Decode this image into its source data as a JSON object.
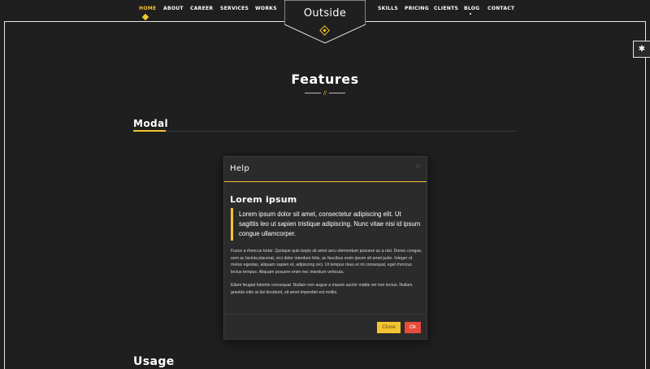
{
  "nav": {
    "left": [
      "HOME",
      "ABOUT",
      "CAREER",
      "SERVICES",
      "WORKS"
    ],
    "right": [
      "SKILLS",
      "PRICING",
      "CLIENTS",
      "BLOG",
      "CONTACT"
    ]
  },
  "logo": {
    "text": "Outside"
  },
  "settings": {
    "icon": "gear-icon",
    "glyph": "✱"
  },
  "page": {
    "title": "Features",
    "separator_mark": "//",
    "section_modal": "Modal",
    "section_usage": "Usage"
  },
  "modal": {
    "title": "Help",
    "close_glyph": "×",
    "heading": "Lorem ipsum",
    "quote": "Lorem ipsum dolor sit amet, consectetur adipiscing elit. Ut sagittis leo ut sapien tristique adipiscing. Nunc vitae nisi id ipsum congue ullamcorper.",
    "paragraph1": "Fusce a rhoncus tortor. Quisque quis turpis sit amet arcu elementum posuere ac a nisi. Donec congue, sem ac lacinia placerat, orci dolor interdum felis, ac faucibus enim ipsum sit amet justo. Integer ut metus egestas, aliquam sapien et, adipiscing orci. Ut tempus risus et mi consequat, eget rhoncus lectus tempus. Aliquam posuere enim nec interdum vehicula.",
    "paragraph2": "Etiam feugiat lobortis consequat. Nullam non augue a mauris auctor mattis vel non lectus. Nullam gravida odio at dui tincidunt, sit amet imperdiet est mollis.",
    "buttons": {
      "close": "Close",
      "ok": "Ok"
    }
  },
  "colors": {
    "accent": "#f4c430",
    "danger": "#e74c3c",
    "background": "#1f1f1f",
    "modal_bg": "#2b2b2b"
  }
}
